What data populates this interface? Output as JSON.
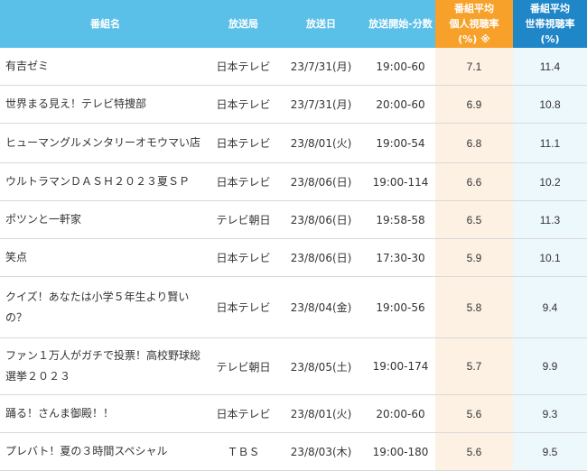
{
  "header": {
    "program": "番組名",
    "station": "放送局",
    "date": "放送日",
    "time": "放送開始-分数",
    "personal": [
      "番組平均",
      "個人視聴率",
      "(%) ※"
    ],
    "household": [
      "番組平均",
      "世帯視聴率",
      "(%)"
    ]
  },
  "rows": [
    {
      "program": "有吉ゼミ",
      "station": "日本テレビ",
      "date": "23/7/31(月)",
      "time": "19:00-60",
      "personal": "7.1",
      "household": "11.4"
    },
    {
      "program": "世界まる見え！テレビ特捜部",
      "station": "日本テレビ",
      "date": "23/7/31(月)",
      "time": "20:00-60",
      "personal": "6.9",
      "household": "10.8"
    },
    {
      "program": "ヒューマングルメンタリーオモウマい店",
      "station": "日本テレビ",
      "date": "23/8/01(火)",
      "time": "19:00-54",
      "personal": "6.8",
      "household": "11.1"
    },
    {
      "program": "ウルトラマンＤＡＳＨ２０２３夏ＳＰ",
      "station": "日本テレビ",
      "date": "23/8/06(日)",
      "time": "19:00-114",
      "personal": "6.6",
      "household": "10.2"
    },
    {
      "program": "ポツンと一軒家",
      "station": "テレビ朝日",
      "date": "23/8/06(日)",
      "time": "19:58-58",
      "personal": "6.5",
      "household": "11.3"
    },
    {
      "program": "笑点",
      "station": "日本テレビ",
      "date": "23/8/06(日)",
      "time": "17:30-30",
      "personal": "5.9",
      "household": "10.1"
    },
    {
      "program": "クイズ！あなたは小学５年生より賢いの？",
      "station": "日本テレビ",
      "date": "23/8/04(金)",
      "time": "19:00-56",
      "personal": "5.8",
      "household": "9.4"
    },
    {
      "program": "ファン１万人がガチで投票！高校野球総選挙２０２３",
      "station": "テレビ朝日",
      "date": "23/8/05(土)",
      "time": "19:00-174",
      "personal": "5.7",
      "household": "9.9"
    },
    {
      "program": "踊る！さんま御殿！！",
      "station": "日本テレビ",
      "date": "23/8/01(火)",
      "time": "20:00-60",
      "personal": "5.6",
      "household": "9.3"
    },
    {
      "program": "プレバト！夏の３時間スペシャル",
      "station": "ＴＢＳ",
      "date": "23/8/03(木)",
      "time": "19:00-180",
      "personal": "5.6",
      "household": "9.5"
    }
  ]
}
